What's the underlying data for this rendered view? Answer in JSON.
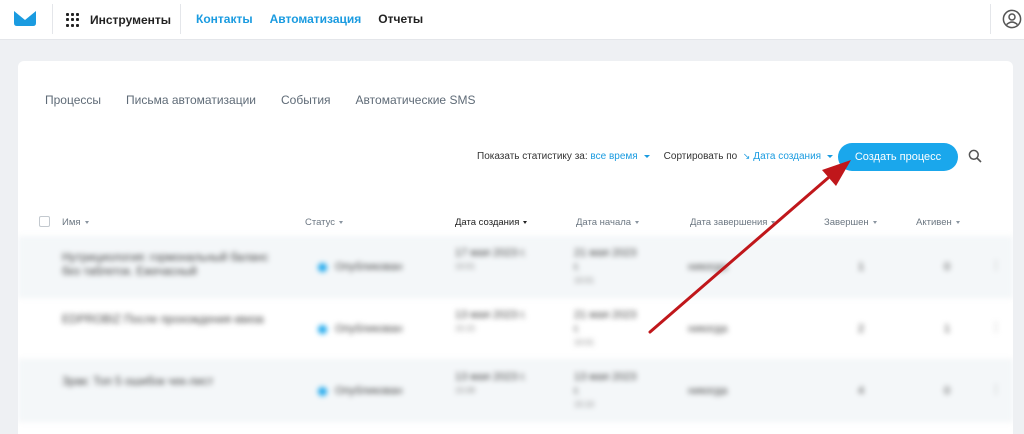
{
  "topbar": {
    "tools_label": "Инструменты",
    "nav": [
      {
        "label": "Контакты",
        "active": true
      },
      {
        "label": "Автоматизация",
        "active": true
      },
      {
        "label": "Отчеты",
        "active": false
      }
    ]
  },
  "subtabs": [
    "Процессы",
    "Письма автоматизации",
    "События",
    "Автоматические SMS"
  ],
  "filters": {
    "stats_label": "Показать статистику за:",
    "stats_value": "все время",
    "sort_label": "Сортировать по",
    "sort_value": "Дата создания"
  },
  "create_button": "Создать процесс",
  "table": {
    "headers": [
      "Имя",
      "Статус",
      "Дата создания",
      "Дата начала",
      "Дата завершения",
      "Завершен",
      "Активен"
    ],
    "active_sort_header": "Дата создания",
    "rows": [
      {
        "name": "Нутрициология: гормональный баланс без таблеток. Ежечасный",
        "status": "Опубликован",
        "created": "17 мая 2023 г.",
        "created_time": "10:01",
        "started": "21 мая 2023 г.",
        "started_time": "10:01",
        "ended": "никогда",
        "done": "1",
        "active": "0"
      },
      {
        "name": "EDPROBIZ После прохождения квиза",
        "status": "Опубликован",
        "created": "13 мая 2023 г.",
        "created_time": "15:15",
        "started": "21 мая 2023 г.",
        "started_time": "10:01",
        "ended": "никогда",
        "done": "2",
        "active": "1"
      },
      {
        "name": "Зрак: Топ 5 ошибок чек-лист",
        "status": "Опубликован",
        "created": "13 мая 2023 г.",
        "created_time": "15:08",
        "started": "13 мая 2023 г.",
        "started_time": "15:10",
        "ended": "никогда",
        "done": "4",
        "active": "0"
      }
    ]
  },
  "colors": {
    "accent": "#1aa7ec",
    "link": "#1a9be0",
    "annotation_arrow": "#c0171b"
  },
  "icons": [
    "mail-logo-icon",
    "grid-icon",
    "user-icon",
    "search-icon"
  ]
}
